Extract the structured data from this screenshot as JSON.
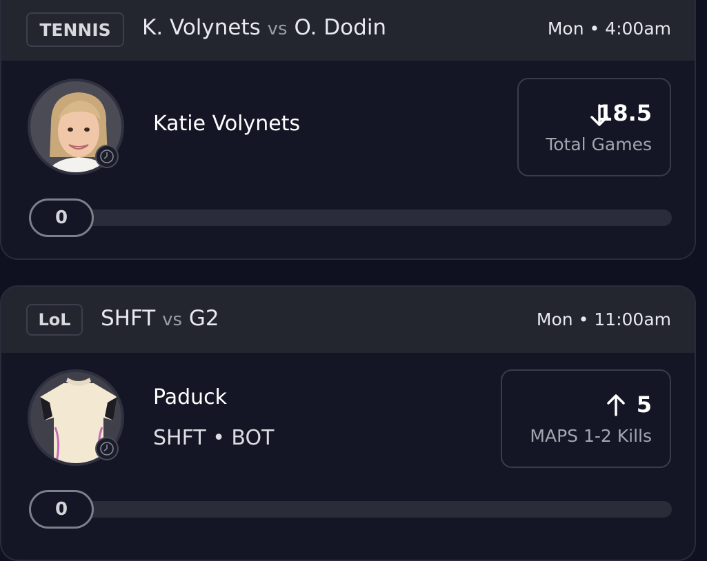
{
  "cards": [
    {
      "sport": "TENNIS",
      "team_a": "K. Volynets",
      "vs": "vs",
      "team_b": "O. Dodin",
      "time": "Mon • 4:00am",
      "player_name": "Katie Volynets",
      "player_sub": "",
      "direction": "down",
      "line_value": "18.5",
      "stat_label": "Total Games",
      "progress_value": "0",
      "progress_fraction": 0
    },
    {
      "sport": "LoL",
      "team_a": "SHFT",
      "vs": "vs",
      "team_b": "G2",
      "time": "Mon • 11:00am",
      "player_name": "Paduck",
      "player_sub": "SHFT • BOT",
      "direction": "up",
      "line_value": "5",
      "stat_label": "MAPS 1-2 Kills",
      "progress_value": "0",
      "progress_fraction": 0
    }
  ],
  "icons": {
    "arrow_down": "arrow-down-icon",
    "arrow_up": "arrow-up-icon",
    "clock": "clock-icon"
  },
  "colors": {
    "background": "#0f1120",
    "card": "#141625",
    "header": "#23252f",
    "border": "#2a2c3c",
    "muted_text": "#a3a5af"
  }
}
